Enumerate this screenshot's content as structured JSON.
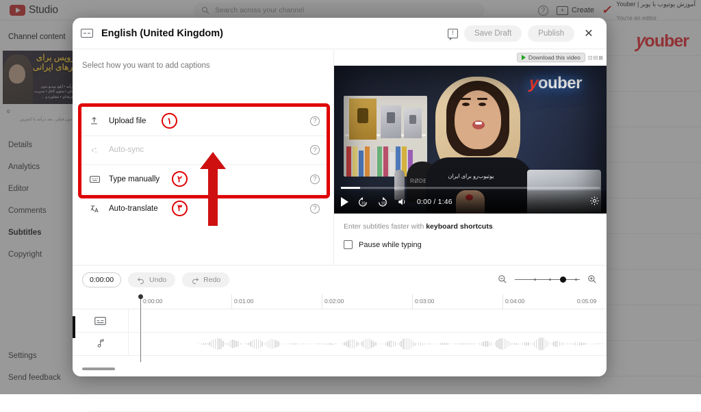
{
  "topbar": {
    "brand": "Studio",
    "search_placeholder": "Search across your channel",
    "help_icon": "?",
    "create_label": "Create",
    "channel_name": "Youber | آموزش یوتیوب با یوبر",
    "channel_role": "You're an editor"
  },
  "sidebar": {
    "title": "Channel content",
    "thumb_headline": "سرویس برای یوبرهای ایرانی",
    "thumb_bullets": "• نقد درآمد\n• آپلود ویدیو بدون فیلترشکن\n• سئوی کانال\n• مدیریت کانال حرفه‌ای\n• مشاوره و ...",
    "video_label": "o",
    "video_sub": "آپلود بدون فیلتر ـ نقد درآمد با کمترین",
    "items": [
      {
        "label": "Details",
        "active": false
      },
      {
        "label": "Analytics",
        "active": false
      },
      {
        "label": "Editor",
        "active": false
      },
      {
        "label": "Comments",
        "active": false
      },
      {
        "label": "Subtitles",
        "active": true
      },
      {
        "label": "Copyright",
        "active": false
      }
    ],
    "bottom_items": [
      {
        "label": "Settings"
      },
      {
        "label": "Send feedback"
      }
    ]
  },
  "background": {
    "watermark": "ouber",
    "watermark_tick": "y"
  },
  "modal": {
    "title": "English (United Kingdom)",
    "title_icon": "cc-icon",
    "feedback_icon": "feedback-icon",
    "save_draft": "Save Draft",
    "publish": "Publish",
    "close": "✕",
    "subtitle_prompt": "Select how you want to add captions",
    "options": [
      {
        "icon": "↑",
        "label": "Upload file",
        "disabled": false,
        "help": "?",
        "marker": "١"
      },
      {
        "icon": "✧",
        "label": "Auto-sync",
        "disabled": true,
        "help": "?",
        "marker": ""
      },
      {
        "icon": "⌨",
        "label": "Type manually",
        "disabled": false,
        "help": "?",
        "marker": "٢"
      },
      {
        "icon": "文",
        "label": "Auto-translate",
        "disabled": false,
        "help": "?",
        "marker": "٣"
      }
    ],
    "annotation_arrow": "up-arrow",
    "annotation_color": "#e00000"
  },
  "preview": {
    "download_chip": "Download this video",
    "download_ctrl": "⊡⊟⊠",
    "video_logo": "ouber",
    "video_logo_tick": "y",
    "video_overlay_text": "یوتیوب‌رو\nبرای ایران",
    "mic_brand": "RØDE",
    "player": {
      "play_icon": "▶",
      "rewind_label": "10",
      "forward_label": "10",
      "volume_icon": "🔊",
      "time": "0:00 / 1:46",
      "settings_icon": "⚙"
    },
    "shortcuts_prefix": "Enter subtitles faster with ",
    "shortcuts_link": "keyboard shortcuts",
    "shortcuts_suffix": ".",
    "pause_checkbox_label": "Pause while typing",
    "pause_checked": false
  },
  "timeline": {
    "current_time": "0:00:00",
    "undo": "Undo",
    "redo": "Redo",
    "zoom_out_icon": "⊖",
    "zoom_in_icon": "⊕",
    "zoom_level": 70,
    "ruler_ticks": [
      "0:00:00",
      "0:01:00",
      "0:02:00",
      "0:03:00",
      "0:04:00",
      "0:05:09"
    ],
    "tracks": [
      {
        "icon": "cc-icon",
        "name": "subtitle-track"
      },
      {
        "icon": "music-note-icon",
        "name": "audio-track"
      }
    ]
  }
}
